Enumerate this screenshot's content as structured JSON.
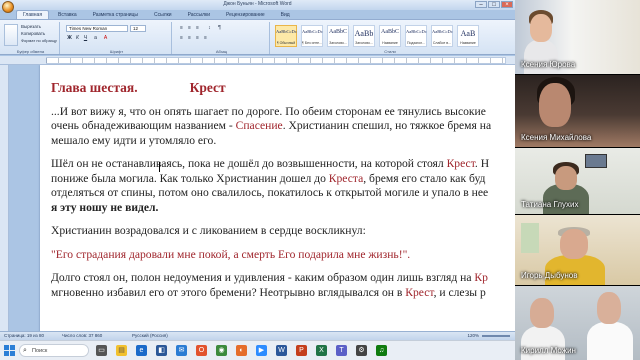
{
  "word": {
    "title": "Джон Буньян - Microsoft Word",
    "tabs": [
      "Главная",
      "Вставка",
      "Разметка страницы",
      "Ссылки",
      "Рассылки",
      "Рецензирование",
      "Вид"
    ],
    "active_tab": "Главная",
    "ribbon": {
      "font_name": "Times New Roman",
      "font_size": "12",
      "clipboard_items": [
        "Вырезать",
        "Копировать",
        "Формат по образцу"
      ],
      "styles": [
        {
          "sample": "AaBbCcDc",
          "name": "¶ Обычный"
        },
        {
          "sample": "AaBbCcDc",
          "name": "¶ Без инте..."
        },
        {
          "sample": "AaBbC",
          "name": "Заголово..."
        },
        {
          "sample": "AaBb",
          "name": "Заголово..."
        },
        {
          "sample": "AaBbC",
          "name": "Название"
        },
        {
          "sample": "AaBbCcDc",
          "name": "Подзагол..."
        },
        {
          "sample": "AaBbCcDc",
          "name": "Слабое в..."
        },
        {
          "sample": "AaB",
          "name": "Название"
        }
      ],
      "group_labels": [
        "Буфер обмена",
        "Шрифт",
        "Абзац",
        "Стили"
      ]
    },
    "document": {
      "chapter_title": "Глава шестая.",
      "chapter_word": "Крест",
      "paragraphs": [
        {
          "parts": [
            {
              "t": "...И вот вижу я, что он опять шагает по дороге. По обеим сторонам ее тянулись высокие"
            }
          ]
        },
        {
          "parts": [
            {
              "t": "очень обнадеживающим названием - "
            },
            {
              "t": "Спасение",
              "red": true
            },
            {
              "t": ". Христианин спешил, но тяжкое бремя на"
            }
          ]
        },
        {
          "parts": [
            {
              "t": "мешало ему идти и утомляло его."
            }
          ]
        },
        {
          "parts": [
            {
              "t": "Шёл он не останавливаясь, пока не дошёл до возвышенности, на которой стоял "
            },
            {
              "t": "Крест",
              "red": true
            },
            {
              "t": ". Н"
            }
          ]
        },
        {
          "parts": [
            {
              "t": "пониже была могила. Как только Христианин дошел до "
            },
            {
              "t": "Креста",
              "red": true
            },
            {
              "t": ", бремя его стало как буд"
            }
          ]
        },
        {
          "parts": [
            {
              "t": "отделяться от спины, потом оно свалилось, покатилось к открытой могиле и упало в нее"
            }
          ]
        },
        {
          "parts": [
            {
              "t": "я эту ношу не видел.",
              "bold": true
            }
          ]
        },
        {
          "parts": [
            {
              "t": "Христианин возрадовался и с ликованием в сердце воскликнул:"
            }
          ]
        },
        {
          "parts": [
            {
              "t": "\"Его страдания даровали мне покой, а смерть Его подарила мне жизнь!\".",
              "red": true
            }
          ]
        },
        {
          "parts": [
            {
              "t": "Долго стоял он, полон недоумения и удивления - каким образом один лишь взгляд на "
            },
            {
              "t": "Кр",
              "red": true
            }
          ]
        },
        {
          "parts": [
            {
              "t": "мгновенно избавил его от этого бремени? Неотрывно вглядывался он в "
            },
            {
              "t": "Крест",
              "red": true
            },
            {
              "t": ", и слезы р"
            }
          ]
        }
      ]
    },
    "statusbar": {
      "page": "Страница: 19 из 80",
      "words": "Число слов: 37 860",
      "language": "Русский (Россия)",
      "zoom": "120%"
    }
  },
  "taskbar": {
    "search_placeholder": "Поиск",
    "time": "",
    "date": ""
  },
  "participants": [
    {
      "name": "Ксения Юрова"
    },
    {
      "name": "Ксения Михайлова"
    },
    {
      "name": "Татиана Глухих"
    },
    {
      "name": "Игорь Дыбунов"
    },
    {
      "name": "Кирилл Можин"
    }
  ]
}
